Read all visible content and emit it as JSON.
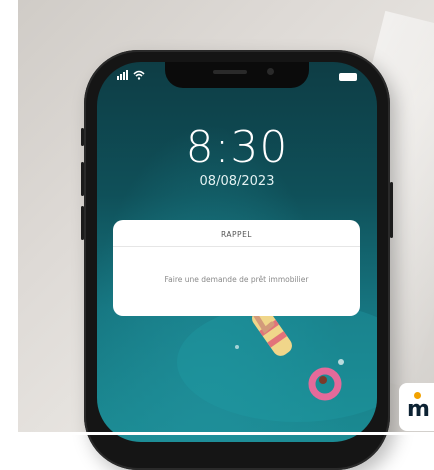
{
  "lockscreen": {
    "time": "8:30",
    "date": "08/08/2023"
  },
  "notification": {
    "title": "RAPPEL",
    "body": "Faire une demande de prêt immobilier"
  },
  "brand": {
    "logo_letter": "m"
  },
  "icons": {
    "signal": "signal-bars-icon",
    "wifi": "wifi-icon",
    "battery": "battery-icon"
  },
  "colors": {
    "screen_top": "#0e3d45",
    "screen_bottom": "#1b8b93",
    "logo_accent": "#f2a200",
    "logo_text": "#0d2233"
  }
}
